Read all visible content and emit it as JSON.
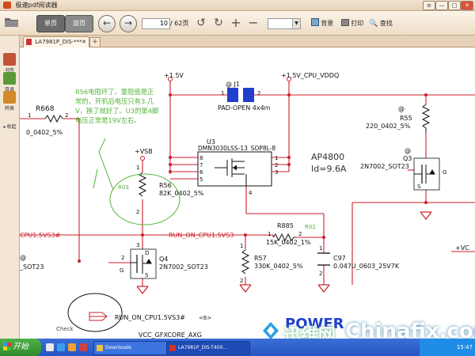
{
  "window": {
    "title": "极速pdf阅读器",
    "controls": [
      "≡",
      "—",
      "□",
      "✕"
    ]
  },
  "toolbar": {
    "single_page": "单页",
    "double_page": "双页",
    "page_current": "10",
    "page_total": "/ 62页",
    "zoom_value": "",
    "background": "背景",
    "print": "打印",
    "search": "查找"
  },
  "sidebar": {
    "items": [
      {
        "label": "书签"
      },
      {
        "label": "目录"
      },
      {
        "label": "转换"
      },
      {
        "label": "收起"
      }
    ]
  },
  "tabs": {
    "doc_tab": "LA7981P_DIS-***",
    "new_tab": "+"
  },
  "schematic": {
    "annotation": "R56电阻坏了。量阻值是正常的，开机后电压只有3.几V，换了就好了。U3的第4脚电压正常是19V左右。",
    "handwritten_r03": "R03",
    "handwritten_r02": "R02",
    "handwritten_check": "Check",
    "p1_5v": "+1.5V",
    "p1_5v_cpu": "+1.5V_CPU_VDDQ",
    "j1_ref": "@ J1",
    "j1_pin1": "1",
    "j1_pin2": "2",
    "j1_part": "PAD-OPEN 4x4m",
    "r668_ref": "R668",
    "r668_val": "0_0402_5%",
    "r668_pin1": "1",
    "r668_pin2": "2",
    "u3_ref": "U3",
    "u3_part": "DMN3030LSS-13_SOP8L-8",
    "u3_pins_left": [
      "8",
      "7",
      "6",
      "5"
    ],
    "u3_pins_right": [
      "1",
      "2",
      "3"
    ],
    "u3_pin4": "4",
    "ap_part": "AP4800",
    "ap_id": "Id=9.6A",
    "r55_ref": "R55",
    "r55_val": "220_0402_5%",
    "r55_at": "@",
    "q3_ref": "Q3",
    "q3_part": "2N7002_SOT23",
    "q3_at": "@",
    "q3_g": "G",
    "q3_s": "S",
    "vsb": "+VSB",
    "r56_ref": "R56",
    "r56_val": "82K_0402_5%",
    "r56_pin1": "1",
    "r56_pin2": "2",
    "net_run_on": "RUN_ON_CPU1.5VS3",
    "net_cpu_left": "CPU1.5VS3#",
    "r885_ref": "R885",
    "r885_val": "15K_0402_1%",
    "r885_pin1": "1",
    "r885_pin2": "2",
    "q4_ref": "Q4",
    "q4_part": "2N7002_SOT23",
    "q4_d": "D",
    "q4_s": "S",
    "q4_g": "G",
    "q4_pin3": "3",
    "q4_pin2": "2",
    "left_at": "@",
    "left_sot": "_SOT23",
    "r57_ref": "R57",
    "r57_val": "330K_0402_5%",
    "r57_pin1": "1",
    "r57_pin2": "2",
    "c97_ref": "C97",
    "c97_val": "0.047U_0603_25V7K",
    "c97_pin1": "1",
    "c97_pin2": "2",
    "offpage_label": "RUN_ON_CPU1.5VS3#",
    "offpage_page": "<6>",
    "vcc_partial": "+VC",
    "vcc_gfx": "VCC_GFXCORE_AXG",
    "power_title": "POWER"
  },
  "taskbar": {
    "start": "开始",
    "items": [
      {
        "label": "Downloads"
      },
      {
        "label": "LA7981P_DIS-T400..."
      }
    ],
    "clock": "15:47"
  },
  "watermark": {
    "cn": "迅维网",
    "site": "Chinafix.com"
  },
  "colors": {
    "wire": "#cc1f2a",
    "ground": "#cc1f2a",
    "component": "#111111",
    "pin_dot": "#cc1f2a",
    "annotation": "#55b33a",
    "j1_fill": "#1f3fcc",
    "power_title": "#1f3fcc"
  }
}
